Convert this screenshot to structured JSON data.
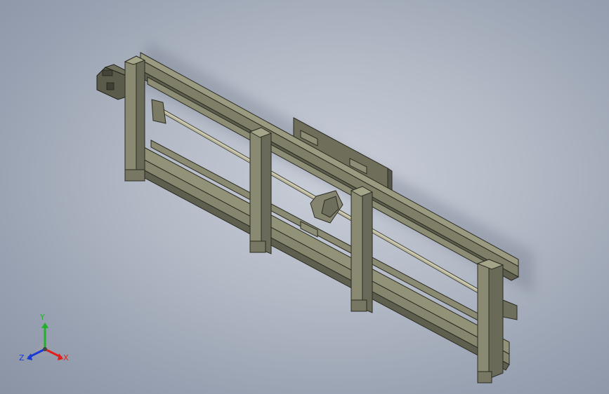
{
  "viewport": {
    "background_top": "#c9ced8",
    "background_bottom": "#8a93a4"
  },
  "model": {
    "part_color": "#7b7b66",
    "part_edge_color": "#2b2b22"
  },
  "triad": {
    "x_label": "X",
    "y_label": "Y",
    "z_label": "Z",
    "x_color": "#e0201a",
    "y_color": "#21b02a",
    "z_color": "#1a3bd6"
  }
}
